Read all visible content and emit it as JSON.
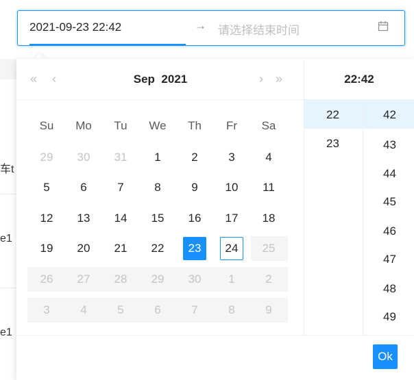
{
  "range": {
    "start_value": "2021-09-23 22:42",
    "arrow": "→",
    "end_placeholder": "请选择结束时间"
  },
  "calendar": {
    "prev_year": "«",
    "prev_month": "‹",
    "next_month": "›",
    "next_year": "»",
    "month": "Sep",
    "year": "2021",
    "weekdays": [
      "Su",
      "Mo",
      "Tu",
      "We",
      "Th",
      "Fr",
      "Sa"
    ],
    "weeks": [
      [
        "29",
        "30",
        "31",
        "1",
        "2",
        "3",
        "4"
      ],
      [
        "5",
        "6",
        "7",
        "8",
        "9",
        "10",
        "11"
      ],
      [
        "12",
        "13",
        "14",
        "15",
        "16",
        "17",
        "18"
      ],
      [
        "19",
        "20",
        "21",
        "22",
        "23",
        "24",
        "25"
      ],
      [
        "26",
        "27",
        "28",
        "29",
        "30",
        "1",
        "2"
      ],
      [
        "3",
        "4",
        "5",
        "6",
        "7",
        "8",
        "9"
      ]
    ],
    "selected_day": "23",
    "today_day": "24"
  },
  "time": {
    "title": "22:42",
    "hours": [
      "22",
      "23"
    ],
    "minutes": [
      "42",
      "43",
      "44",
      "45",
      "46",
      "47",
      "48",
      "49"
    ]
  },
  "footer": {
    "ok_label": "Ok"
  },
  "background": {
    "fragment_1": "车t",
    "fragment_2": "e1",
    "fragment_3": "e1"
  },
  "colors": {
    "accent": "#1890ff",
    "hover_bg": "#e6f4ff",
    "disabled_bg": "#f5f5f5"
  }
}
